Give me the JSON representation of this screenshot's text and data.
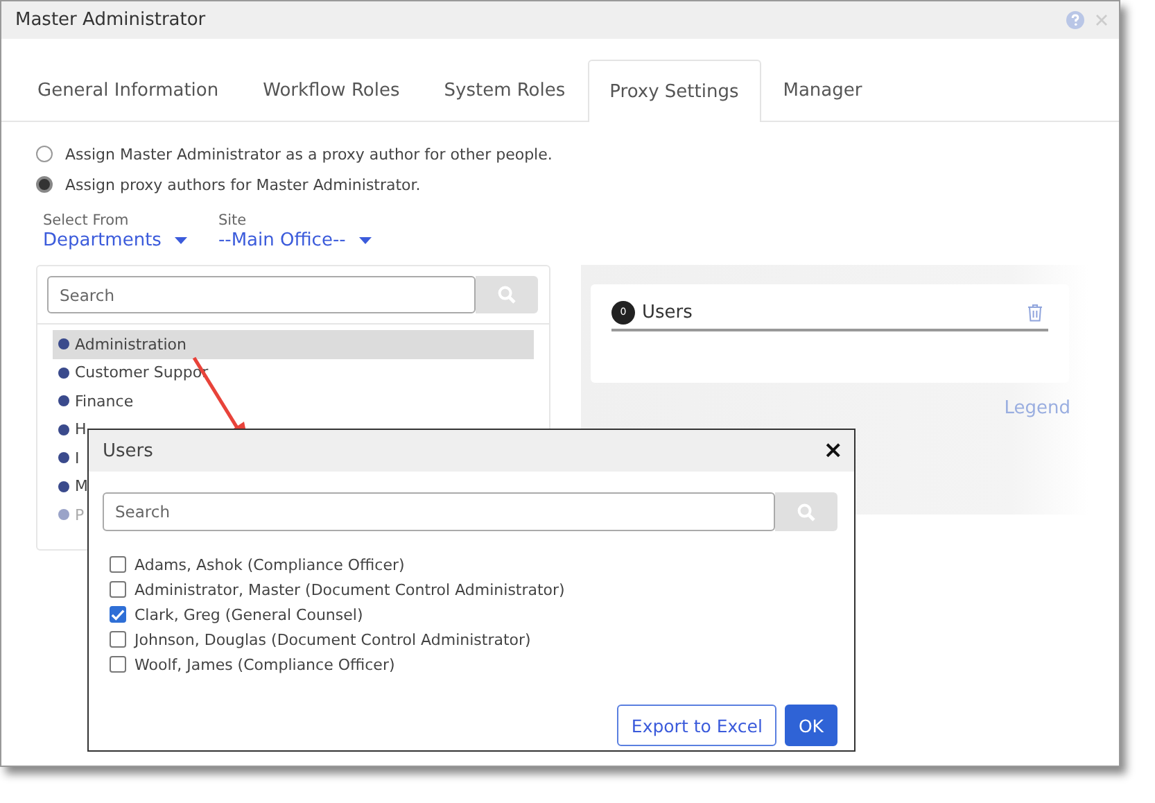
{
  "window": {
    "title": "Master Administrator"
  },
  "tabs": [
    {
      "label": "General Information",
      "selected": false
    },
    {
      "label": "Workflow Roles",
      "selected": false
    },
    {
      "label": "System Roles",
      "selected": false
    },
    {
      "label": "Proxy Settings",
      "selected": true
    },
    {
      "label": "Manager",
      "selected": false
    }
  ],
  "proxy_options": [
    {
      "label": "Assign Master Administrator as a proxy author for other people.",
      "selected": false
    },
    {
      "label": "Assign proxy authors for Master Administrator.",
      "selected": true
    }
  ],
  "select_from": {
    "label": "Select From",
    "value": "Departments"
  },
  "site": {
    "label": "Site",
    "value": "--Main Office--"
  },
  "departments": {
    "search_placeholder": "Search",
    "items": [
      {
        "label": "Administration",
        "selected": true,
        "inactive": false
      },
      {
        "label": "Customer Suppor",
        "selected": false,
        "inactive": false
      },
      {
        "label": "Finance",
        "selected": false,
        "inactive": false
      },
      {
        "label": "H",
        "selected": false,
        "inactive": false
      },
      {
        "label": "I",
        "selected": false,
        "inactive": false
      },
      {
        "label": "M",
        "selected": false,
        "inactive": false
      },
      {
        "label": "P",
        "selected": false,
        "inactive": true
      }
    ]
  },
  "users_panel": {
    "count": "0",
    "title": "Users",
    "legend": "Legend"
  },
  "dialog": {
    "title": "Users",
    "close": "×",
    "search_placeholder": "Search",
    "users": [
      {
        "label": "Adams, Ashok (Compliance Officer)",
        "checked": false
      },
      {
        "label": "Administrator, Master (Document Control Administrator)",
        "checked": false
      },
      {
        "label": "Clark, Greg (General Counsel)",
        "checked": true
      },
      {
        "label": "Johnson, Douglas (Document Control Administrator)",
        "checked": false
      },
      {
        "label": "Woolf, James (Compliance Officer)",
        "checked": false
      }
    ],
    "buttons": [
      {
        "label": "Export to Excel",
        "kind": "secondary"
      },
      {
        "label": "OK",
        "kind": "primary"
      }
    ]
  }
}
